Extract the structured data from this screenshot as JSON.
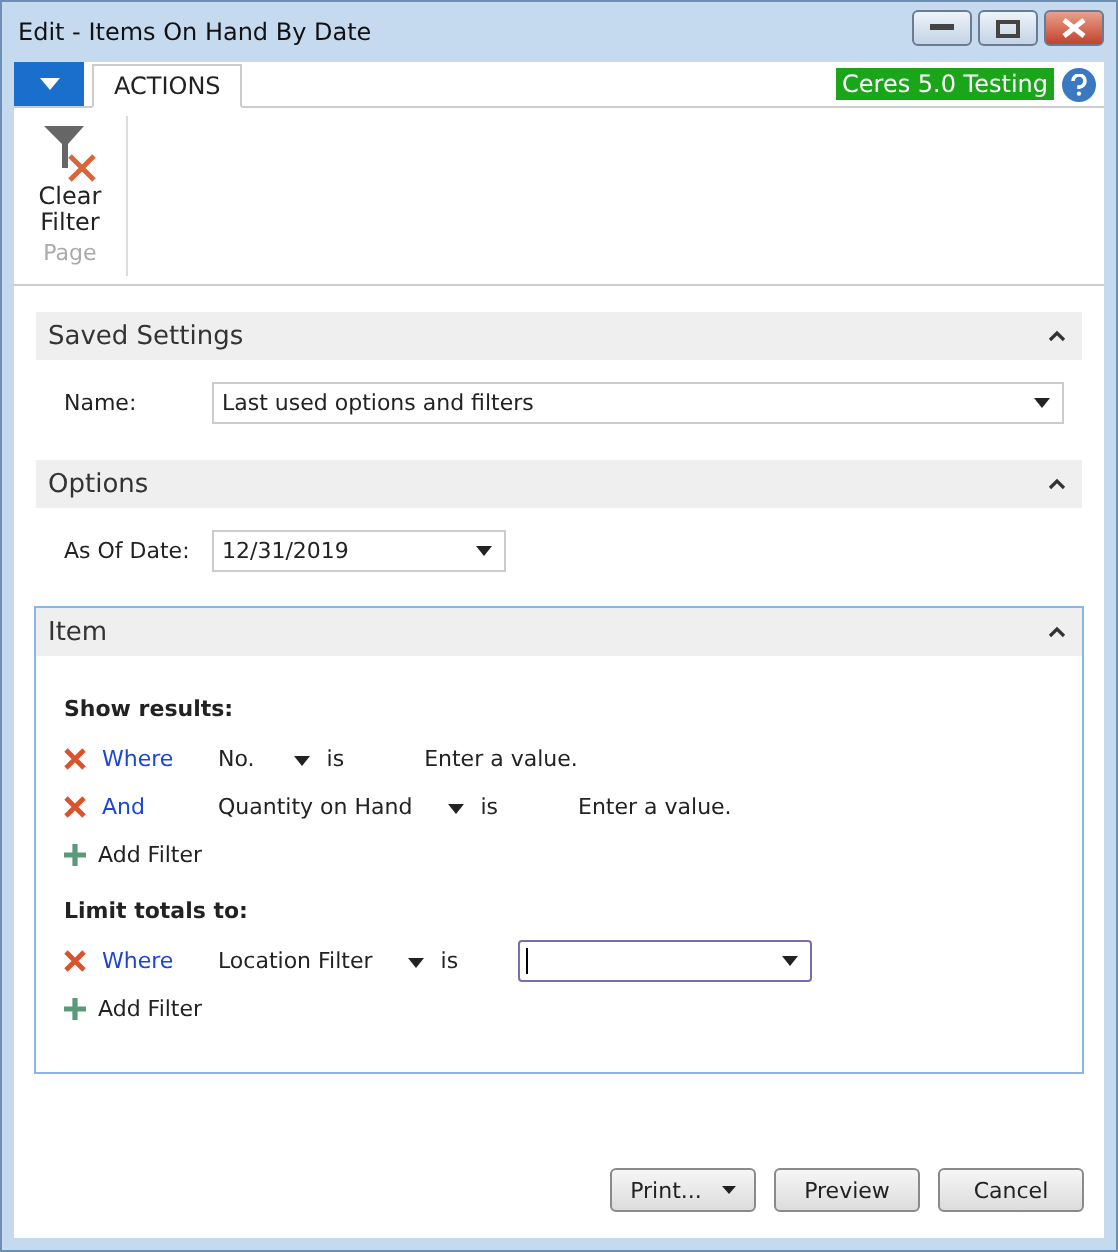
{
  "window": {
    "title": "Edit - Items On Hand By Date"
  },
  "ribbon": {
    "tabs": [
      {
        "label": "ACTIONS",
        "selected": true
      }
    ],
    "badge": "Ceres 5.0 Testing",
    "groups": [
      {
        "label": "Page",
        "actions": [
          {
            "label": "Clear Filter"
          }
        ]
      }
    ]
  },
  "sections": [
    {
      "title": "Saved Settings",
      "expanded": true,
      "active": false,
      "kind": "fields",
      "fields": [
        {
          "label": "Name:",
          "value": "Last used options and filters",
          "wide": true
        }
      ]
    },
    {
      "title": "Options",
      "expanded": true,
      "active": false,
      "kind": "fields",
      "fields": [
        {
          "label": "As Of Date:",
          "value": "12/31/2019",
          "wide": false
        }
      ]
    },
    {
      "title": "Item",
      "expanded": true,
      "active": true,
      "kind": "filters",
      "groups": [
        {
          "heading": "Show results:",
          "filters": [
            {
              "kind": "text",
              "connector": "Where",
              "field": "No.",
              "operator": "is",
              "placeholder": "Enter a value."
            },
            {
              "kind": "text",
              "connector": "And",
              "field": "Quantity on Hand",
              "operator": "is",
              "placeholder": "Enter a value."
            }
          ],
          "add": "Add Filter"
        },
        {
          "heading": "Limit totals to:",
          "filters": [
            {
              "kind": "dropdown",
              "connector": "Where",
              "field": "Location Filter",
              "operator": "is"
            }
          ],
          "add": "Add Filter"
        }
      ]
    }
  ],
  "buttons": [
    {
      "label": "Print...",
      "menu": true
    },
    {
      "label": "Preview",
      "menu": false
    },
    {
      "label": "Cancel",
      "menu": false
    }
  ]
}
